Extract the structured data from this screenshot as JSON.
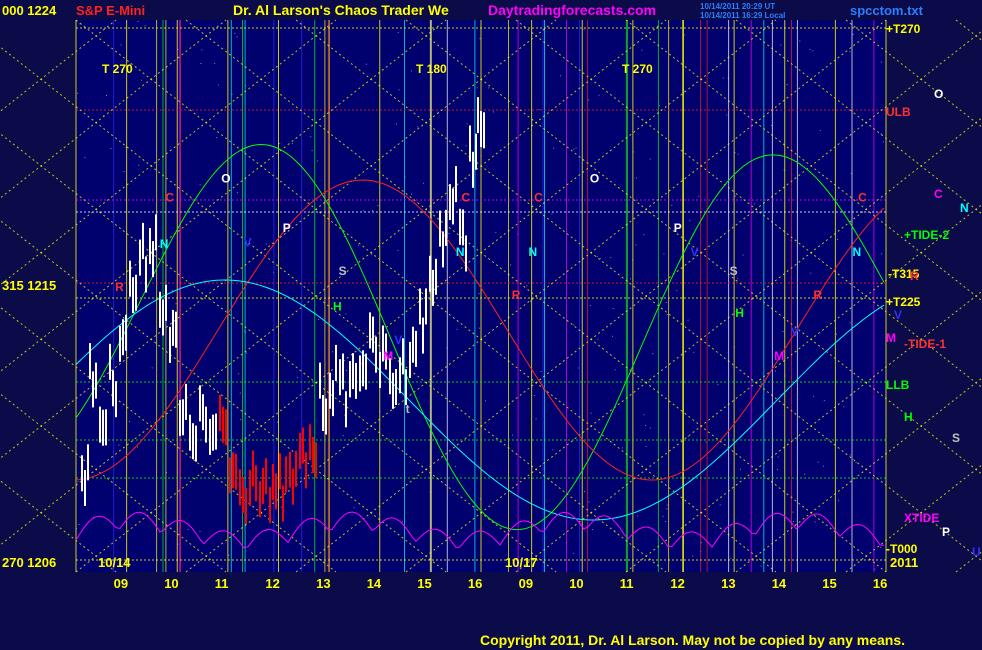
{
  "header": {
    "left_values": "000  1224",
    "instrument": "S&P E-Mini",
    "title": "Dr. Al Larson's Chaos Trader We",
    "site": "Daytradingforecasts.com",
    "timestamp_1": "10/14/2011 20:29 UT",
    "timestamp_2": "10/14/2011 16:29 Local",
    "file": "spcctom.txt"
  },
  "footer": {
    "copyright": "Copyright 2011, Dr. Al Larson. May not be copied by any means."
  },
  "colors": {
    "background": "#0b0b4a",
    "plot_bg": "#00006e",
    "yellow": "#ffff00",
    "red": "#ff0000",
    "green": "#00ff00",
    "cyan": "#00ffff",
    "magenta": "#ff00ff",
    "white": "#ffffff"
  },
  "chart_data": {
    "type": "line",
    "x_tick_labels": [
      "09",
      "10",
      "11",
      "12",
      "13",
      "14",
      "15",
      "16",
      "09",
      "10",
      "11",
      "12",
      "13",
      "14",
      "15",
      "16"
    ],
    "date_labels": [
      "10/14",
      "10/17"
    ],
    "y_axis_labels": [
      {
        "angle": "000",
        "price": "1224"
      },
      {
        "angle": "315",
        "price": "1215"
      },
      {
        "angle": "270",
        "price": "1206"
      }
    ],
    "bottom_right_label": "2011",
    "right_labels": [
      {
        "text": "+T270",
        "color": "#ffff00"
      },
      {
        "text": "ULB",
        "color": "#ff3030"
      },
      {
        "text": "O",
        "color": "#ffffff"
      },
      {
        "text": "C",
        "color": "#ff00ff"
      },
      {
        "text": "N",
        "color": "#00ffff"
      },
      {
        "text": "+TIDE-2",
        "color": "#00ff00"
      },
      {
        "text": "-T315",
        "color": "#ffff00"
      },
      {
        "text": "R",
        "color": "#ff3030"
      },
      {
        "text": "+T225",
        "color": "#ffff00"
      },
      {
        "text": "V",
        "color": "#3030ff"
      },
      {
        "text": "M",
        "color": "#ff00ff"
      },
      {
        "text": "-TIDE-1",
        "color": "#ff3030"
      },
      {
        "text": "LLB",
        "color": "#00ff00"
      },
      {
        "text": "H",
        "color": "#00ff00"
      },
      {
        "text": "S",
        "color": "#c0c0c0"
      },
      {
        "text": "XTIDE",
        "color": "#ff00ff"
      },
      {
        "text": "P",
        "color": "#ffffff"
      },
      {
        "text": "-T000",
        "color": "#ffff00"
      },
      {
        "text": "U",
        "color": "#3030ff"
      }
    ],
    "top_markers": [
      {
        "text": "T  270",
        "day": 0
      },
      {
        "text": "T  180",
        "day": 1
      },
      {
        "text": "T  270",
        "day": 2
      }
    ],
    "planet_markers": [
      {
        "text": "C",
        "color": "#ff3030",
        "x": 0.16,
        "y": 0.74
      },
      {
        "text": "O",
        "color": "#ffffff",
        "x": 0.26,
        "y": 0.86
      },
      {
        "text": "P",
        "color": "#ffffff",
        "x": 0.37,
        "y": 0.55
      },
      {
        "text": "N",
        "color": "#00ffff",
        "x": 0.15,
        "y": 0.45
      },
      {
        "text": "V",
        "color": "#3030ff",
        "x": 0.3,
        "y": 0.46
      },
      {
        "text": "R",
        "color": "#ff3030",
        "x": 0.07,
        "y": 0.18
      },
      {
        "text": "S",
        "color": "#c0c0c0",
        "x": 0.47,
        "y": 0.28
      },
      {
        "text": "H",
        "color": "#00ff00",
        "x": 0.46,
        "y": 0.06
      },
      {
        "text": "V",
        "color": "#3030ff",
        "x": 0.57,
        "y": -0.15
      },
      {
        "text": "M",
        "color": "#ff00ff",
        "x": 0.55,
        "y": -0.25
      },
      {
        "text": "t",
        "color": "#c0c0c0",
        "x": 0.59,
        "y": -0.58
      },
      {
        "text": "C",
        "color": "#ff3030",
        "x": 0.69,
        "y": 0.74
      },
      {
        "text": "N",
        "color": "#00ffff",
        "x": 0.68,
        "y": 0.4
      },
      {
        "text": "R",
        "color": "#ff3030",
        "x": 0.78,
        "y": 0.13
      },
      {
        "text": "C",
        "color": "#ff3030",
        "x": 0.82,
        "y": 0.74
      },
      {
        "text": "N",
        "color": "#00ffff",
        "x": 0.81,
        "y": 0.4
      },
      {
        "text": "O",
        "color": "#ffffff",
        "x": 0.92,
        "y": 0.86
      },
      {
        "text": "P",
        "color": "#ffffff",
        "x": 1.07,
        "y": 0.55
      },
      {
        "text": "V",
        "color": "#3030ff",
        "x": 1.1,
        "y": 0.4
      },
      {
        "text": "S",
        "color": "#c0c0c0",
        "x": 1.17,
        "y": 0.28
      },
      {
        "text": "H",
        "color": "#00ff00",
        "x": 1.18,
        "y": 0.02
      },
      {
        "text": "M",
        "color": "#ff00ff",
        "x": 1.25,
        "y": -0.25
      },
      {
        "text": "V",
        "color": "#3030ff",
        "x": 1.28,
        "y": -0.1
      },
      {
        "text": "R",
        "color": "#ff3030",
        "x": 1.32,
        "y": 0.13
      },
      {
        "text": "C",
        "color": "#ff3030",
        "x": 1.4,
        "y": 0.74
      },
      {
        "text": "N",
        "color": "#00ffff",
        "x": 1.39,
        "y": 0.4
      }
    ]
  }
}
